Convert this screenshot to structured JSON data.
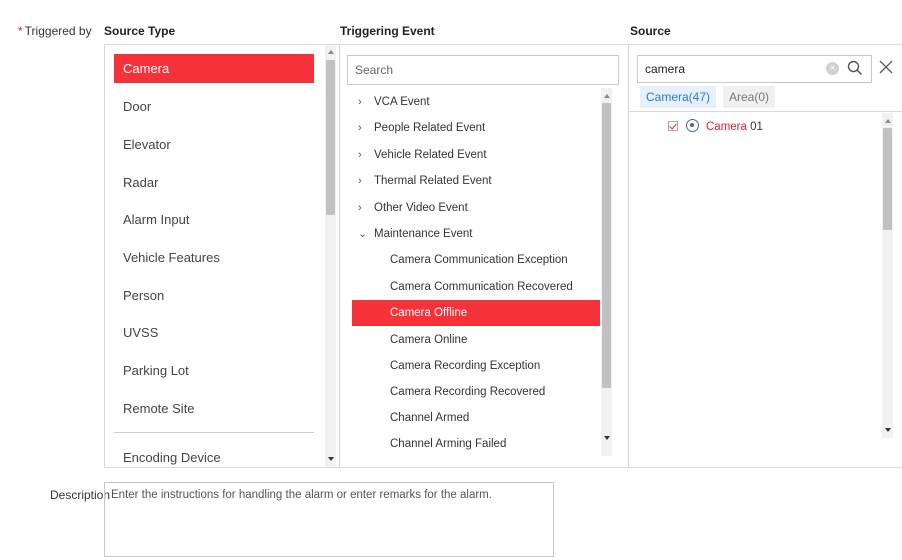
{
  "triggered_by": {
    "required_mark": "*",
    "label": "Triggered by"
  },
  "headers": {
    "source_type": "Source Type",
    "triggering_event": "Triggering Event",
    "source": "Source"
  },
  "source_types": [
    "Camera",
    "Door",
    "Elevator",
    "Radar",
    "Alarm Input",
    "Vehicle Features",
    "Person",
    "UVSS",
    "Parking Lot",
    "Remote Site",
    "Encoding Device"
  ],
  "selected_source_type": "Camera",
  "event_search": {
    "placeholder": "Search",
    "value": ""
  },
  "events": [
    {
      "label": "VCA Event",
      "expandable": true,
      "expanded": false
    },
    {
      "label": "People Related Event",
      "expandable": true,
      "expanded": false
    },
    {
      "label": "Vehicle Related Event",
      "expandable": true,
      "expanded": false
    },
    {
      "label": "Thermal Related Event",
      "expandable": true,
      "expanded": false
    },
    {
      "label": "Other Video Event",
      "expandable": true,
      "expanded": false
    },
    {
      "label": "Maintenance Event",
      "expandable": true,
      "expanded": true
    },
    {
      "label": "Camera Communication Exception",
      "child": true
    },
    {
      "label": "Camera Communication Recovered",
      "child": true
    },
    {
      "label": "Camera Offline",
      "child": true,
      "selected": true
    },
    {
      "label": "Camera Online",
      "child": true
    },
    {
      "label": "Camera Recording Exception",
      "child": true
    },
    {
      "label": "Camera Recording Recovered",
      "child": true
    },
    {
      "label": "Channel Armed",
      "child": true
    },
    {
      "label": "Channel Arming Failed",
      "child": true
    }
  ],
  "source_search": {
    "value": "camera",
    "placeholder": ""
  },
  "source_tabs": [
    {
      "label": "Camera(47)",
      "active": true
    },
    {
      "label": "Area(0)",
      "active": false
    }
  ],
  "source_results": [
    {
      "highlight": "Camera",
      "rest": " 01",
      "checked": true,
      "icon": "camera-icon"
    }
  ],
  "description": {
    "label": "Description",
    "placeholder": "Enter the instructions for handling the alarm or enter remarks for the alarm."
  },
  "colors": {
    "accent_red": "#f5323a",
    "tab_blue": "#2f79c9",
    "border": "#d9d9d9"
  }
}
